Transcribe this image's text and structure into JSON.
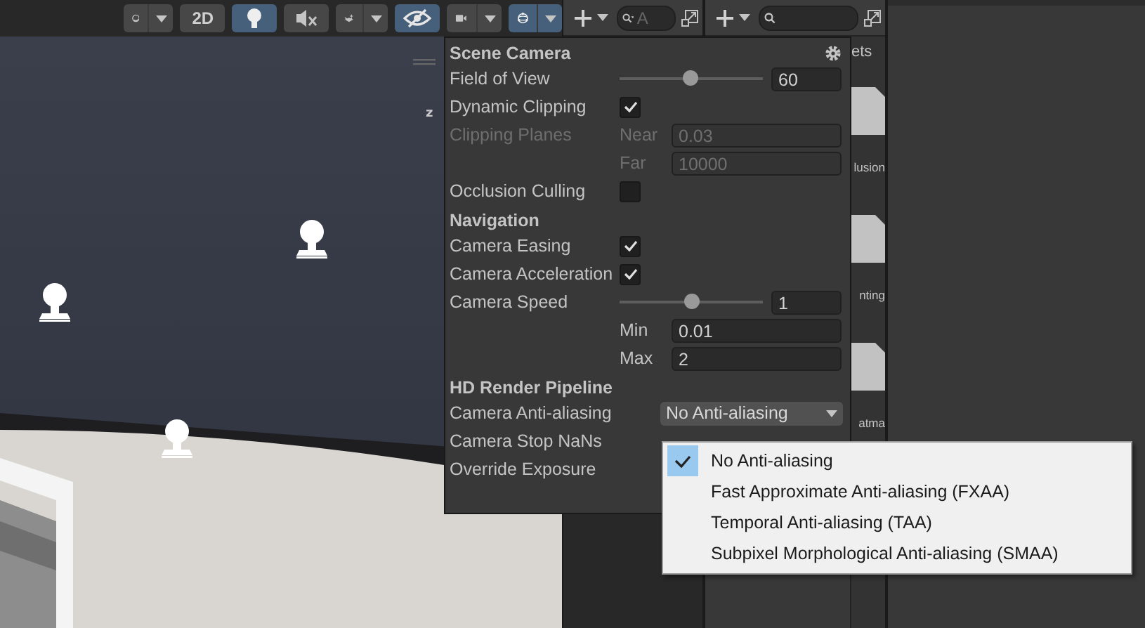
{
  "scene_toolbar": [
    {
      "kind": "shading",
      "selected": false,
      "dropdown": true
    },
    {
      "kind": "text",
      "label": "2D",
      "selected": false,
      "dropdown": false
    },
    {
      "kind": "light",
      "selected": true,
      "dropdown": false
    },
    {
      "kind": "audio",
      "selected": false,
      "dropdown": false
    },
    {
      "kind": "effects",
      "selected": false,
      "dropdown": true
    },
    {
      "kind": "visibility",
      "selected": true,
      "dropdown": false
    },
    {
      "kind": "camera",
      "selected": false,
      "dropdown": true
    },
    {
      "kind": "gizmos",
      "selected": true,
      "dropdown": true
    }
  ],
  "scene": {
    "axis_label": "z"
  },
  "hierarchy": {
    "search": {
      "placeholder": "A"
    }
  },
  "project": {
    "breadcrumb": "ets",
    "items": [
      {
        "label": "lusion"
      },
      {
        "label": "nting"
      },
      {
        "label": "atma"
      }
    ]
  },
  "scene_camera_popup": {
    "sections": [
      {
        "title": "Scene Camera",
        "settings": true,
        "rows": [
          {
            "kind": "slider",
            "label": "Field of View",
            "level": 0.49,
            "value": "60"
          },
          {
            "kind": "checkbox",
            "label": "Dynamic Clipping",
            "checked": true
          },
          {
            "kind": "fields",
            "label": "Clipping Planes",
            "disabled": true,
            "fields": [
              {
                "label": "Near",
                "value": "0.03"
              },
              {
                "label": "Far",
                "value": "10000"
              }
            ]
          },
          {
            "kind": "checkbox",
            "label": "Occlusion Culling",
            "checked": false
          }
        ]
      },
      {
        "title": "Navigation",
        "settings": false,
        "rows": [
          {
            "kind": "checkbox",
            "label": "Camera Easing",
            "checked": true
          },
          {
            "kind": "checkbox",
            "label": "Camera Acceleration",
            "checked": true
          },
          {
            "kind": "slider",
            "label": "Camera Speed",
            "level": 0.5,
            "value": "1"
          },
          {
            "kind": "fields",
            "disabled": false,
            "fields": [
              {
                "label": "Min",
                "value": "0.01"
              },
              {
                "label": "Max",
                "value": "2"
              }
            ]
          }
        ]
      },
      {
        "title": "HD Render Pipeline",
        "settings": false,
        "rows": [
          {
            "kind": "dropdown",
            "label": "Camera Anti-aliasing",
            "value": "No Anti-aliasing"
          },
          {
            "kind": "label",
            "label": "Camera Stop NaNs"
          },
          {
            "kind": "label",
            "label": "Override Exposure"
          }
        ]
      }
    ]
  },
  "anti_aliasing_menu": [
    {
      "label": "No Anti-aliasing",
      "selected": true
    },
    {
      "label": "Fast Approximate Anti-aliasing (FXAA)",
      "selected": false
    },
    {
      "label": "Temporal Anti-aliasing (TAA)",
      "selected": false
    },
    {
      "label": "Subpixel Morphological Anti-aliasing (SMAA)",
      "selected": false
    }
  ]
}
